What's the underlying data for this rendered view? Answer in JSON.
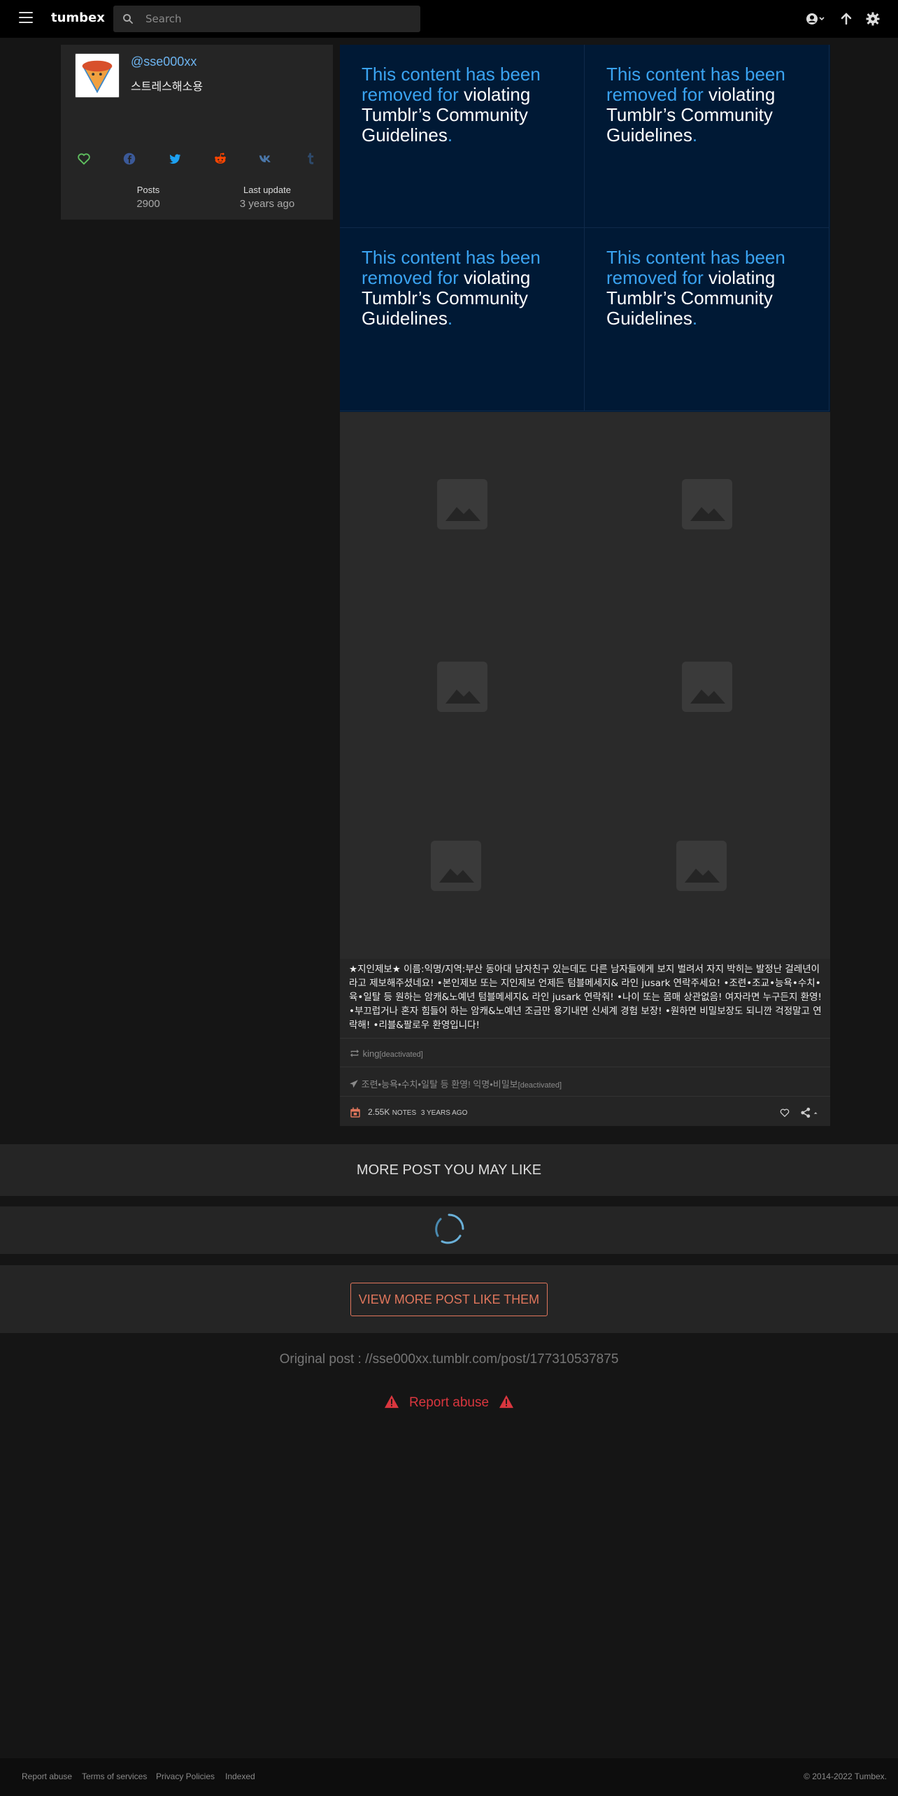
{
  "header": {
    "brand": "tumbex",
    "search_placeholder": "Search"
  },
  "profile": {
    "username": "@sse000xx",
    "bio": "스트레스해소용",
    "stats": [
      {
        "label": "Posts",
        "value": "2900"
      },
      {
        "label": "Last update",
        "value": "3 years ago"
      }
    ]
  },
  "post": {
    "removed_notice": {
      "part1": "This content has been removed for",
      "part2": " violating Tumblr’s Community Guidelines",
      "part3": "."
    },
    "caption": "★지인제보★ 이름:익명/지역:부산 동아대 남자친구 있는데도 다른 남자들에게 보지 벌려서 자지 박히는 발정난 걸레년이라고 제보해주셨네요! •본인제보 또는 지인제보 언제든 텀블메세지& 라인 jusark 연락주세요! •조련•조교•능욕•수치•육•일탈 등 원하는 암캐&노예년 텀블메세지& 라인 jusark 연락줘! •나이 또는 몸매 상관없음! 여자라면 누구든지 환영! •부끄럽거나 혼자 힘들어 하는 암캐&노예년 조금만 용기내면 신세계 경험 보장! •원하면 비밀보장도 되니깐 걱정말고 연락해! •리블&팔로우 환영입니다!",
    "reblog_from": "king",
    "reblog_from_status": "[deactivated]",
    "source": "조련•능욕•수치•일탈 등 환영! 익명•비밀보",
    "source_status": "[deactivated]",
    "notes_count": "2.55K",
    "notes_label": "NOTES",
    "time_ago": "3 YEARS AGO"
  },
  "more": {
    "title": "MORE POST YOU MAY LIKE",
    "view_more_label": "VIEW MORE POST LIKE THEM"
  },
  "original_post": "Original post : //sse000xx.tumblr.com/post/177310537875",
  "report_label": "Report abuse",
  "footer": {
    "links": [
      "Report abuse",
      "Terms of services",
      "Privacy Policies",
      "Indexed"
    ],
    "copyright": "© 2014-2022 Tumbex."
  },
  "colors": {
    "accent_blue": "#3aa3f0",
    "removed_bg": "#001935",
    "button_accent": "#e0765c",
    "report_red": "#d9363e"
  }
}
